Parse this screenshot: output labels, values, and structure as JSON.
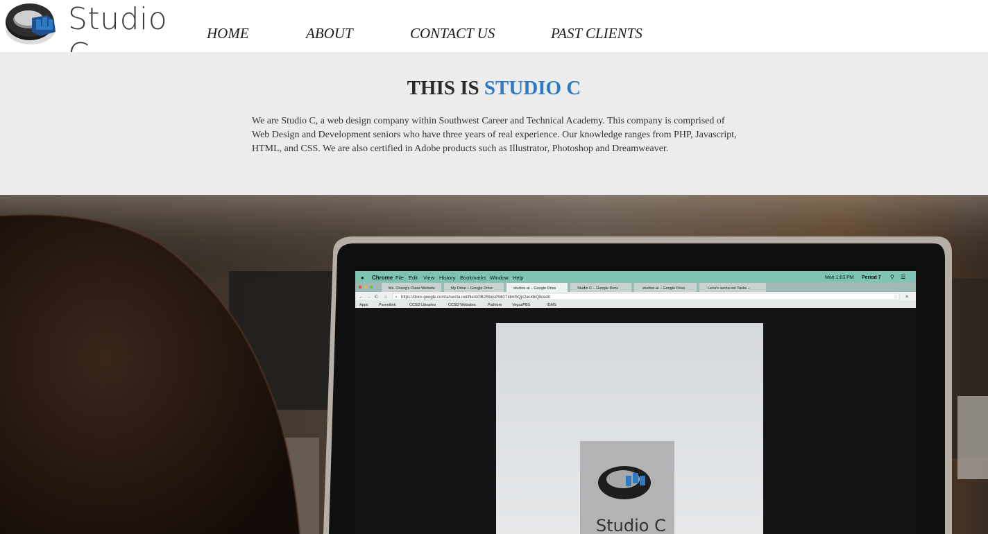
{
  "brand": {
    "name": "Studio C"
  },
  "nav": {
    "items": [
      {
        "label": "HOME"
      },
      {
        "label": "ABOUT"
      },
      {
        "label": "CONTACT US"
      },
      {
        "label": "PAST CLIENTS"
      }
    ]
  },
  "intro": {
    "heading_prefix": "THIS IS",
    "heading_accent": "STUDIO C",
    "body": "We are Studio C, a web design company within Southwest Career and Technical Academy. This company is comprised of Web Design and Development seniors who have three years of real experience. Our knowledge ranges from PHP, Javascript, HTML, and CSS. We are also certified in Adobe products such as Illustrator, Photoshop and Dreamweaver."
  },
  "hero_photo": {
    "menubar": {
      "app": "Chrome",
      "items": [
        "File",
        "Edit",
        "View",
        "History",
        "Bookmarks",
        "Window",
        "Help"
      ],
      "clock": "Mon 1:03 PM",
      "user": "Period 7"
    },
    "tabs": [
      "Ms. Chang's Class Website",
      "My Drive – Google Drive",
      "studioc.ai – Google Drive",
      "Studio C – Google Docs",
      "studioc.ai – Google Drive",
      "Lena's swcta.net Tasks –"
    ],
    "url": "https://docs.google.com/a/swcta.net/file/d/0B2RbqsPMi0TIdml5Qjc2aUdkQlk/edit",
    "bookmarks": [
      "Apps",
      "Parentlink",
      "CCSD Libraries",
      "CCSD Websites",
      "Pathlore",
      "VegasPBS",
      "IDMS"
    ],
    "preview_logo_text": "Studio C"
  },
  "colors": {
    "accent": "#2e7bc4",
    "intro_bg": "#ececec",
    "browser_chrome": "#7fc3b2"
  }
}
